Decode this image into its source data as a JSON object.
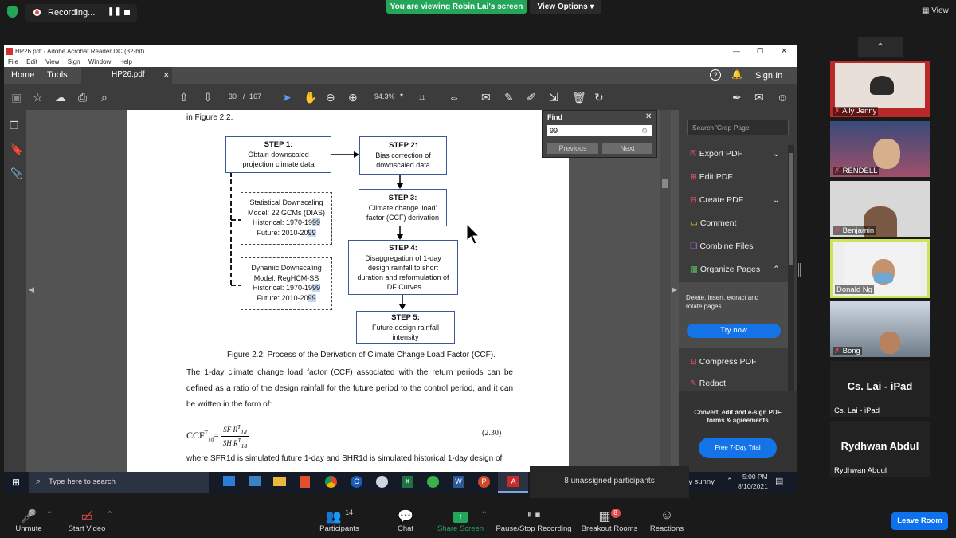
{
  "zoom_top": {
    "recording_label": "Recording...",
    "share_banner": "You are viewing Robin Lai's screen",
    "view_options": "View Options",
    "view_label": "View"
  },
  "acrobat": {
    "title": "HP26.pdf - Adobe Acrobat Reader DC (32-bit)",
    "menu": [
      "File",
      "Edit",
      "View",
      "Sign",
      "Window",
      "Help"
    ],
    "tabs": {
      "home": "Home",
      "tools": "Tools",
      "doc": "HP26.pdf",
      "sign_in": "Sign In"
    },
    "toolbar": {
      "page_current": "30",
      "page_sep": "/",
      "page_total": "167",
      "zoom": "94.3%"
    },
    "find": {
      "title": "Find",
      "query": "99",
      "previous": "Previous",
      "next": "Next"
    },
    "right_panel": {
      "search_placeholder": "Search 'Crop Page'",
      "items": [
        "Export PDF",
        "Edit PDF",
        "Create PDF",
        "Comment",
        "Combine Files",
        "Organize Pages"
      ],
      "organize_desc": "Delete, insert, extract and rotate pages.",
      "try_now": "Try now",
      "items2": [
        "Compress PDF",
        "Redact"
      ],
      "promo": "Convert, edit and e-sign PDF forms & agreements",
      "trial": "Free 7-Day Trial"
    }
  },
  "document": {
    "intro": "in Figure 2.2.",
    "steps": [
      {
        "head": "STEP 1:",
        "lines": [
          "Obtain downscaled",
          "projection climate data"
        ]
      },
      {
        "head": "STEP 2:",
        "lines": [
          "Bias correction of",
          "downscaled data"
        ]
      },
      {
        "head": "STEP 3:",
        "lines": [
          "Climate change 'load'",
          "factor (CCF) derivation"
        ]
      },
      {
        "head": "STEP 4:",
        "lines": [
          "Disaggregation of 1-day",
          "design rainfall to short",
          "duration and reformulation of",
          "IDF Curves"
        ]
      },
      {
        "head": "STEP 5:",
        "lines": [
          "Future design rainfall",
          "intensity"
        ]
      }
    ],
    "stat_box": {
      "l1": "Statistical Downscaling",
      "l2": "Model: 22 GCMs (DIAS)",
      "hist_a": "Historical: 1970-19",
      "hist_b": "99",
      "fut_a": "Future: 2010-20",
      "fut_b": "99"
    },
    "dyn_box": {
      "l1": "Dynamic Downscaling",
      "l2": "Model: RegHCM-SS",
      "hist_a": "Historical: 1970-19",
      "hist_b": "99",
      "fut_a": "Future: 2010-20",
      "fut_b": "99"
    },
    "caption": "Figure 2.2: Process of the Derivation of Climate Change Load Factor (CCF).",
    "para": "The 1-day climate change load factor (CCF) associated with the return periods can be defined as a ratio of the design rainfall for the future period to the control period, and it can be written in the form of:",
    "eq_lhs": "CCF",
    "eq_number": "(2.30)",
    "where_line": "where SFR1d is simulated future 1-day and SHR1d is simulated historical 1-day design of"
  },
  "participants": [
    {
      "name": "Ally Jenny",
      "muted": true
    },
    {
      "name": "RENDELL",
      "muted": true
    },
    {
      "name": "Benjamin",
      "muted": true
    },
    {
      "name": "Donald Ng",
      "muted": false
    },
    {
      "name": "Bong",
      "muted": true
    },
    {
      "name": "Cs. Lai - iPad",
      "big": "Cs. Lai - iPad"
    },
    {
      "name": "Rydhwan Abdul",
      "big": "Rydhwan Abdul"
    }
  ],
  "taskbar": {
    "search": "Type here to search",
    "unassigned": "8 unassigned participants",
    "weather": "ly sunny",
    "time": "5:00 PM",
    "date": "8/10/2021"
  },
  "zoom_bottom": {
    "unmute": "Unmute",
    "start_video": "Start Video",
    "participants": "Participants",
    "participants_count": "14",
    "chat": "Chat",
    "share_screen": "Share Screen",
    "pause_recording": "Pause/Stop Recording",
    "breakout": "Breakout Rooms",
    "breakout_badge": "8",
    "reactions": "Reactions",
    "leave": "Leave Room"
  },
  "colors": {
    "zoom_green": "#23a55a",
    "acrobat_blue": "#1473e6",
    "leave_blue": "#0e72ed"
  }
}
